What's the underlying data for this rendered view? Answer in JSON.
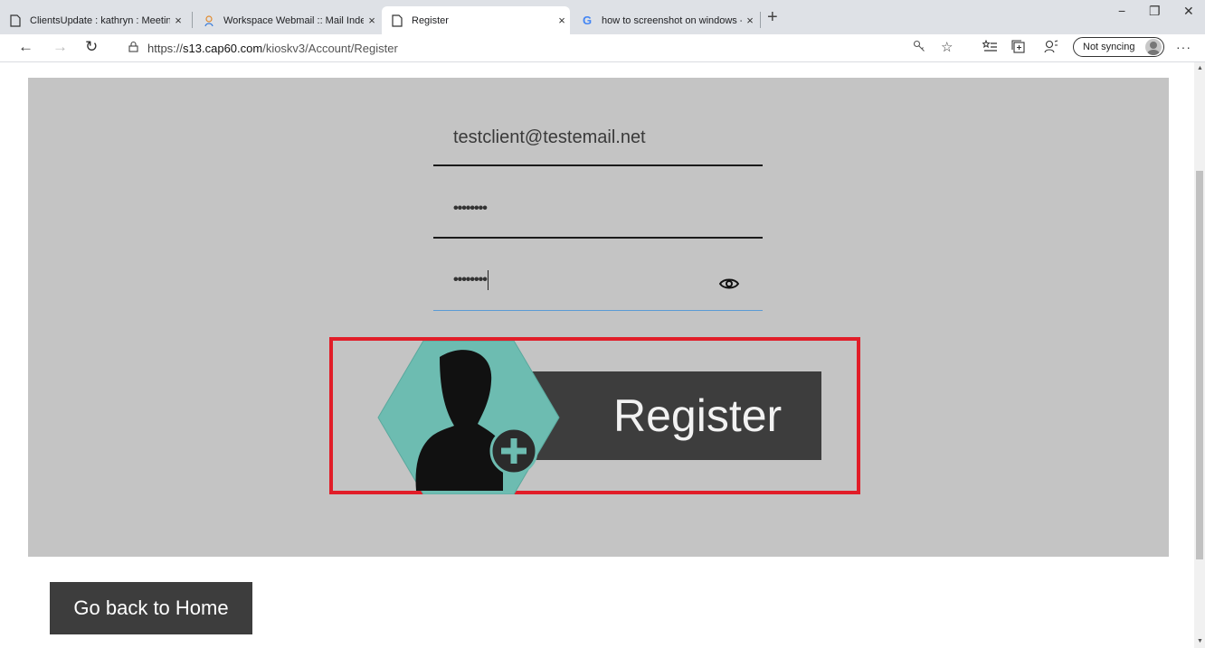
{
  "browser": {
    "tabs": [
      {
        "title": "ClientsUpdate : kathryn : Meeting",
        "close": "×"
      },
      {
        "title": "Workspace Webmail :: Mail Index",
        "close": "×"
      },
      {
        "title": "Register",
        "close": "×"
      },
      {
        "title": "how to screenshot on windows -",
        "close": "×"
      }
    ],
    "new_tab": "+",
    "window_controls": {
      "minimize": "−",
      "restore": "❐",
      "close": "✕"
    },
    "nav": {
      "back": "←",
      "forward": "→",
      "refresh": "↻"
    },
    "url_scheme": "https://",
    "url_host": "s13.cap60.com",
    "url_path": "/kioskv3/Account/Register",
    "sync_label": "Not syncing",
    "more": "···"
  },
  "form": {
    "email_value": "testclient@testemail.net",
    "password_mask": "••••••••",
    "confirm_mask": "••••••••"
  },
  "register_button": {
    "label": "Register",
    "accent_color": "#6dbcb1",
    "bar_color": "#3d3d3d"
  },
  "home_button": {
    "label": "Go back to Home"
  },
  "colors": {
    "panel": "#c4c4c4",
    "highlight_border": "#e11d28"
  }
}
